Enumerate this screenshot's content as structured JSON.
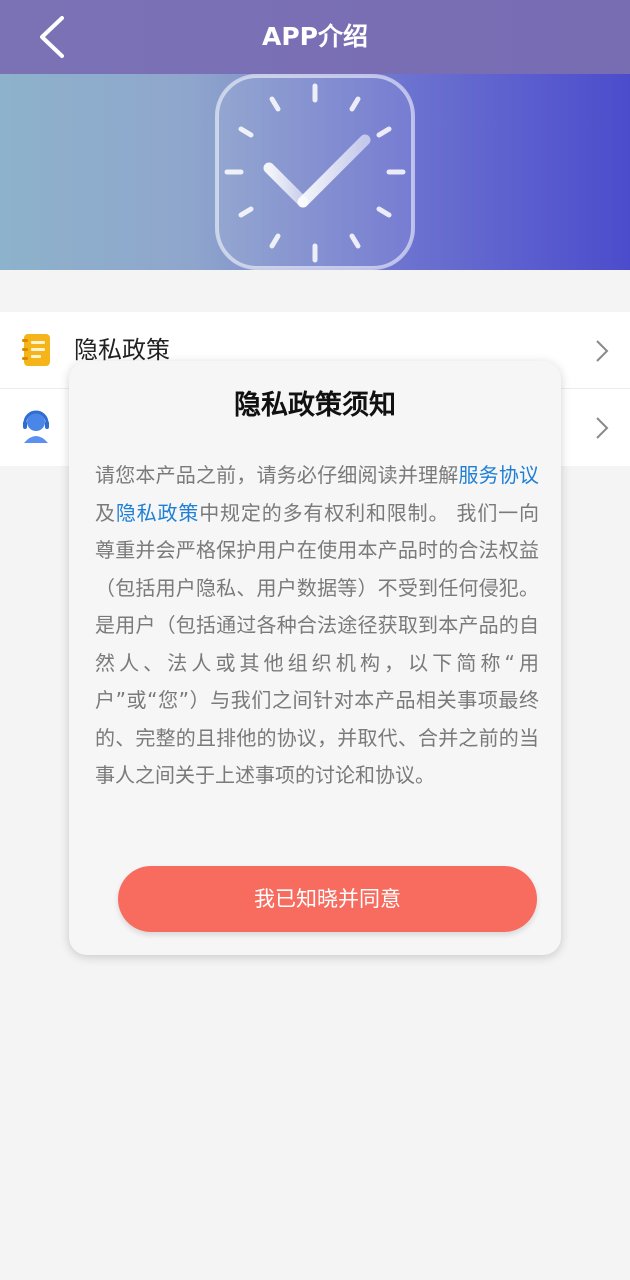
{
  "header": {
    "title": "APP介绍",
    "back_icon": "chevron-left-icon"
  },
  "banner": {
    "icon": "clock-icon"
  },
  "menu": {
    "items": [
      {
        "label": "隐私政策",
        "icon": "notebook-icon"
      },
      {
        "label": "",
        "icon": "customer-service-icon"
      }
    ]
  },
  "dialog": {
    "title": "隐私政策须知",
    "body_part1": "请您本产品之前，请务必仔细阅读并理解",
    "link_service": "服务协议",
    "body_part2": "及",
    "link_privacy": "隐私政策",
    "body_part3": "中规定的多有权利和限制。 我们一向尊重并会严格保护用户在使用本产品时的合法权益（包括用户隐私、用户数据等）不受到任何侵犯。是用户（包括通过各种合法途径获取到本产品的自然人、法人或其他组织机构，以下简称“用户”或“您”）与我们之间针对本产品相关事项最终的、完整的且排他的协议，并取代、合并之前的当事人之间关于上述事项的讨论和协议。",
    "agree_label": "我已知晓并同意"
  },
  "colors": {
    "header": "#7b72b6",
    "accent_button": "#f76c5f",
    "link": "#1e7fd6"
  }
}
